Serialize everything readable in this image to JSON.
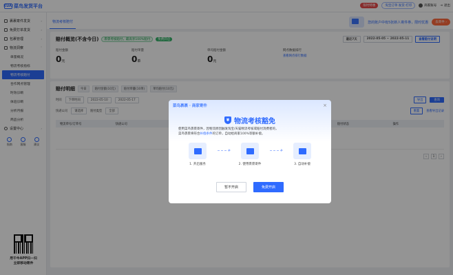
{
  "header": {
    "logo_mark": "KUAI",
    "logo_text": "菜鸟发货平台",
    "badge_red": "限时特惠",
    "badge_outline": "淘宝订单·发货·打印",
    "user_name": "商家账号",
    "exit_label": "退出"
  },
  "sidebar": {
    "groups": [
      {
        "label": "裹裹寄件发货",
        "icon": "package-icon"
      },
      {
        "label": "免费打单发货",
        "icon": "print-icon"
      },
      {
        "label": "包裹管理",
        "icon": "box-icon"
      },
      {
        "label": "物流洞察",
        "icon": "chart-icon",
        "expanded": true
      }
    ],
    "sub_items": [
      "单量概况",
      "物流考核指标",
      "物流考核赔付",
      "合作网点管理",
      "时效诊断",
      "体验诊断",
      "分析月报",
      "商品分析"
    ],
    "active_sub": "物流考核赔付",
    "settings_label": "设置中心",
    "quick": [
      {
        "label": "指南",
        "icon": "guide-icon"
      },
      {
        "label": "客服",
        "icon": "headset-icon"
      },
      {
        "label": "建议",
        "icon": "feedback-icon"
      }
    ],
    "qr_caption_1": "用千牛APP扫一扫",
    "qr_caption_2": "立即移动寄件"
  },
  "main": {
    "tab": "物流考核赔付",
    "promo_text": "您的账户中有5张新人寄件券，限时优惠",
    "promo_button": "去寄件 ›",
    "overview": {
      "title": "赔付概览(不含今日)",
      "tag": "裹裹考核赔付，最高享100%赔付",
      "tag2": "免费开启",
      "filter_select": "最近7天",
      "filter_date": "2022-05-05 ~ 2022-05-11",
      "filter_button": "查看赔付说明",
      "stats": [
        {
          "label": "赔付金额",
          "value": "0",
          "unit": "元",
          "link": ""
        },
        {
          "label": "赔付单量",
          "value": "0",
          "unit": "单",
          "link": ""
        },
        {
          "label": "单均赔付金额",
          "value": "0",
          "unit": "元",
          "link": ""
        },
        {
          "label": "网点数据排行",
          "value": "",
          "unit": "",
          "link": "查看网点排行数据"
        }
      ]
    },
    "detail": {
      "title": "赔付明细",
      "tabs": [
        "今日",
        "赔付金额(10元)",
        "赔付单量(10单)",
        "单均赔付(10元)"
      ],
      "form_label_time": "时间",
      "form_time_select": "下单时间",
      "form_start": "2022-05-10",
      "form_end": "2022-05-17",
      "form_label_company": "快递公司",
      "form_company_select": "请选择",
      "form_label_type": "赔付类型",
      "form_type_select": "全部",
      "search_button": "查询",
      "export_button": "导出",
      "reset_button": "重置",
      "export_records": "查看导出记录",
      "columns": [
        "物流单号/订单号",
        "快递公司",
        "下单时间",
        "考核类型",
        "赔付金额",
        "赔付状态",
        "操作"
      ],
      "pager": [
        "‹",
        "1",
        "›"
      ]
    }
  },
  "modal": {
    "brand": "菜鸟裹裹 · 商家寄件",
    "close": "×",
    "shield_glyph": "¥",
    "title": "物流考核豁免",
    "desc_1": "使用菜鸟裹裹寄件，因物流原因触发淘宝/天猫物流考核或赔付消费者的，",
    "desc_2": "菜鸟裹裹将符合",
    "desc_highlight": "补偿条件",
    "desc_3": "的订单，自动给商家100%等额补偿。",
    "steps": [
      {
        "label": "1. 开启服务",
        "icon": "monitor-icon"
      },
      {
        "label": "2. 使用裹裹寄件",
        "icon": "parcel-icon"
      },
      {
        "label": "3. 自动补偿",
        "icon": "card-icon"
      }
    ],
    "btn_cancel": "暂不开启",
    "btn_confirm": "免费开启"
  }
}
